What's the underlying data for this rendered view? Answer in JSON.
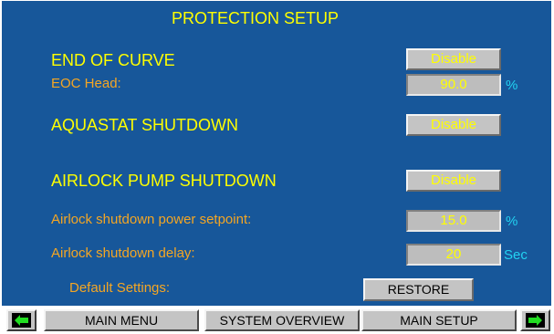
{
  "title": "PROTECTION SETUP",
  "end_of_curve": {
    "label": "END OF CURVE",
    "value": "Disable"
  },
  "eoc_head": {
    "label": "EOC Head:",
    "value": "90.0",
    "unit": "%"
  },
  "aquastat": {
    "label": "AQUASTAT SHUTDOWN",
    "value": "Disable"
  },
  "airlock": {
    "label": "AIRLOCK PUMP SHUTDOWN",
    "value": "Disable"
  },
  "airlock_power": {
    "label": "Airlock shutdown power setpoint:",
    "value": "15.0",
    "unit": "%"
  },
  "airlock_delay": {
    "label": "Airlock shutdown delay:",
    "value": "20",
    "unit": "Sec"
  },
  "defaults": {
    "label": "Default Settings:",
    "button": "RESTORE"
  },
  "nav": {
    "main_menu": "MAIN MENU",
    "system_overview": "SYSTEM OVERVIEW",
    "main_setup": "MAIN SETUP",
    "prev_icon": "arrow-left-icon",
    "next_icon": "arrow-right-icon"
  },
  "colors": {
    "background": "#17579a",
    "heading": "#ffff00",
    "label": "#f5a623",
    "unit": "#22d3f2",
    "arrow": "#22dd22"
  }
}
